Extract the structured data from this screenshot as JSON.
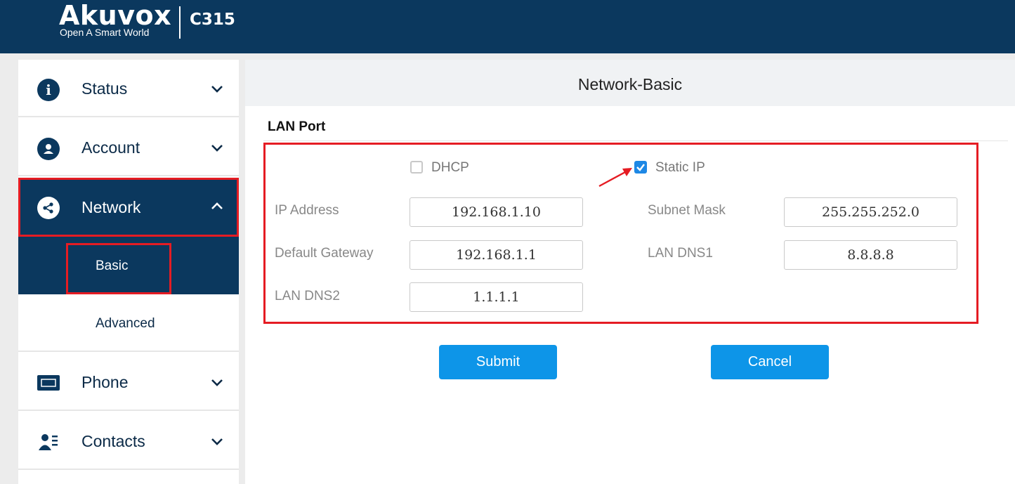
{
  "header": {
    "brand": "Akuvox",
    "tagline": "Open A Smart World",
    "model": "C315"
  },
  "sidebar": {
    "items": [
      {
        "label": "Status",
        "icon": "info-icon"
      },
      {
        "label": "Account",
        "icon": "user-icon"
      },
      {
        "label": "Network",
        "icon": "network-share-icon"
      },
      {
        "label": "Phone",
        "icon": "monitor-icon"
      },
      {
        "label": "Contacts",
        "icon": "contacts-icon"
      }
    ],
    "network_sub": {
      "basic": "Basic",
      "advanced": "Advanced"
    }
  },
  "page": {
    "title": "Network-Basic",
    "section": "LAN Port"
  },
  "form": {
    "dhcp_label": "DHCP",
    "dhcp_checked": false,
    "static_label": "Static IP",
    "static_checked": true,
    "ip_address_label": "IP Address",
    "ip_address": "192.168.1.10",
    "subnet_label": "Subnet Mask",
    "subnet": "255.255.252.0",
    "gateway_label": "Default Gateway",
    "gateway": "192.168.1.1",
    "dns1_label": "LAN DNS1",
    "dns1": "8.8.8.8",
    "dns2_label": "LAN DNS2",
    "dns2": "1.1.1.1"
  },
  "buttons": {
    "submit": "Submit",
    "cancel": "Cancel"
  },
  "colors": {
    "header_bg": "#0b385e",
    "accent_blue": "#0d95e8",
    "highlight_red": "#e51c23"
  }
}
